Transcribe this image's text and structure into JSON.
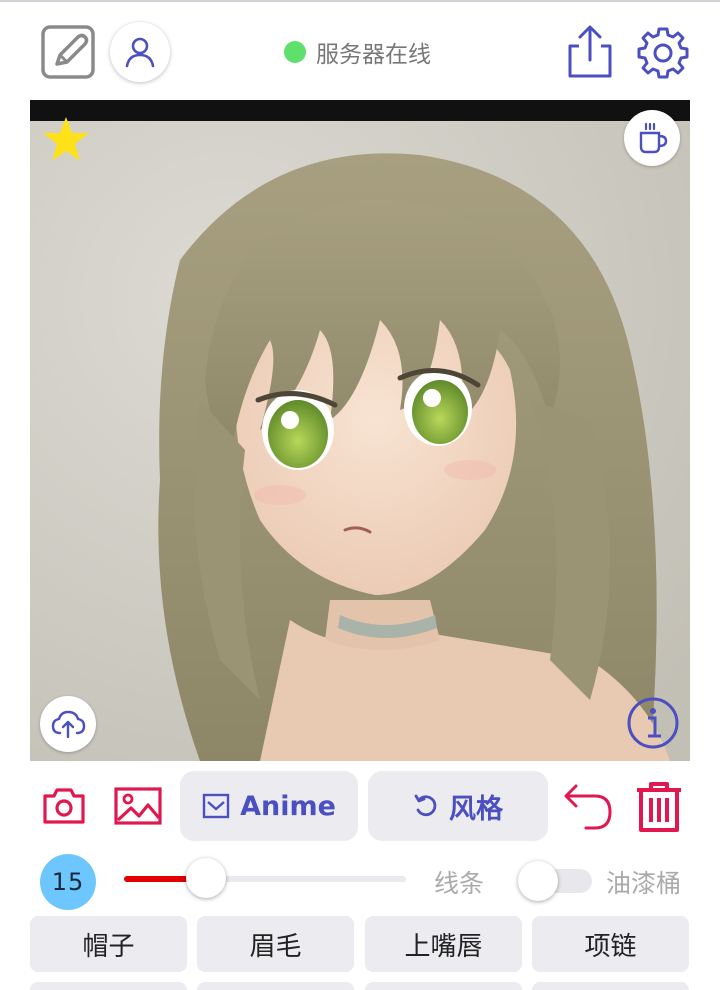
{
  "status": {
    "text": "服务器在线",
    "color": "#5fe06a"
  },
  "topbar": {
    "left_icons": [
      "edit-icon",
      "user-icon"
    ],
    "right_icons": [
      "share-icon",
      "gear-icon"
    ],
    "accent": "#4b4fbf"
  },
  "canvas": {
    "content": "anime-portrait-image",
    "overlay_icons": [
      "star-icon",
      "coffee-cup-icon",
      "cloud-upload-icon",
      "info-icon"
    ]
  },
  "actions": {
    "camera_icon": "camera-icon",
    "gallery_icon": "image-icon",
    "model_label": "Anime",
    "style_label": "风格",
    "undo_icon": "undo-icon",
    "delete_icon": "trash-icon",
    "icon_color": "#e0184f"
  },
  "brush": {
    "size": "15",
    "slider_value_fraction": 0.29,
    "slider_color": "#e00000",
    "mode_line": "线条",
    "mode_bucket": "油漆桶",
    "bucket_enabled": false
  },
  "chips": [
    "帽子",
    "眉毛",
    "上嘴唇",
    "项链"
  ]
}
